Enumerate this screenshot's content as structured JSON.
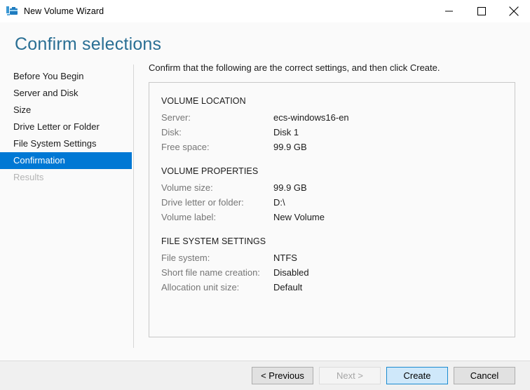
{
  "window": {
    "title": "New Volume Wizard",
    "icon": "server-manager-toolbox-icon",
    "controls": {
      "minimize": "minimize-icon",
      "maximize": "maximize-icon",
      "close": "close-icon"
    }
  },
  "page": {
    "title": "Confirm selections",
    "title_color": "#2a6f94"
  },
  "sidebar": {
    "items": [
      {
        "label": "Before You Begin",
        "state": "normal"
      },
      {
        "label": "Server and Disk",
        "state": "normal"
      },
      {
        "label": "Size",
        "state": "normal"
      },
      {
        "label": "Drive Letter or Folder",
        "state": "normal"
      },
      {
        "label": "File System Settings",
        "state": "normal"
      },
      {
        "label": "Confirmation",
        "state": "selected"
      },
      {
        "label": "Results",
        "state": "disabled"
      }
    ],
    "selected_color": "#0078d4"
  },
  "main": {
    "instruction": "Confirm that the following are the correct settings, and then click Create.",
    "sections": [
      {
        "title": "VOLUME LOCATION",
        "rows": [
          {
            "label": "Server:",
            "value": "ecs-windows16-en"
          },
          {
            "label": "Disk:",
            "value": "Disk 1"
          },
          {
            "label": "Free space:",
            "value": "99.9 GB"
          }
        ]
      },
      {
        "title": "VOLUME PROPERTIES",
        "rows": [
          {
            "label": "Volume size:",
            "value": "99.9 GB"
          },
          {
            "label": "Drive letter or folder:",
            "value": "D:\\"
          },
          {
            "label": "Volume label:",
            "value": "New Volume"
          }
        ]
      },
      {
        "title": "FILE SYSTEM SETTINGS",
        "rows": [
          {
            "label": "File system:",
            "value": "NTFS"
          },
          {
            "label": "Short file name creation:",
            "value": "Disabled"
          },
          {
            "label": "Allocation unit size:",
            "value": "Default"
          }
        ]
      }
    ]
  },
  "footer": {
    "buttons": [
      {
        "label": "< Previous",
        "state": "normal"
      },
      {
        "label": "Next >",
        "state": "disabled"
      },
      {
        "label": "Create",
        "state": "default"
      },
      {
        "label": "Cancel",
        "state": "normal"
      }
    ]
  }
}
